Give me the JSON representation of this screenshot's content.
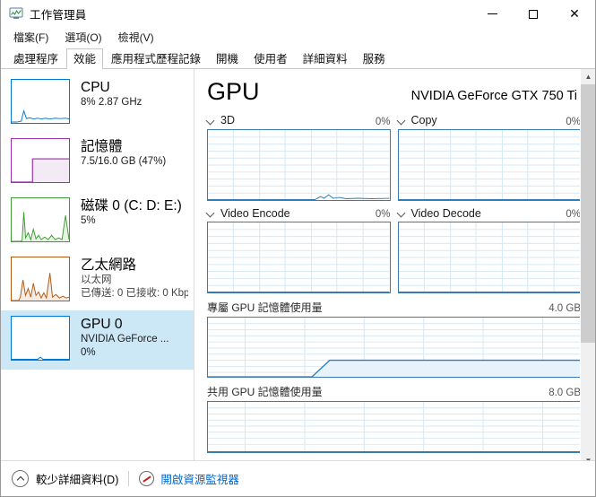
{
  "window": {
    "title": "工作管理員",
    "icon": "task-manager-icon",
    "minimize_label": "—",
    "maximize_label": "□",
    "close_label": "✕"
  },
  "menu": {
    "items": [
      {
        "label": "檔案(F)"
      },
      {
        "label": "選項(O)"
      },
      {
        "label": "檢視(V)"
      }
    ]
  },
  "tabs": {
    "active_index": 1,
    "items": [
      {
        "label": "處理程序"
      },
      {
        "label": "效能"
      },
      {
        "label": "應用程式歷程記錄"
      },
      {
        "label": "開機"
      },
      {
        "label": "使用者"
      },
      {
        "label": "詳細資料"
      },
      {
        "label": "服務"
      }
    ]
  },
  "sidebar": {
    "items": [
      {
        "title": "CPU",
        "sub1": "8%  2.87 GHz",
        "sub2": "",
        "sub3": "",
        "color": "#0078d7",
        "selected": false
      },
      {
        "title": "記憶體",
        "sub1": "7.5/16.0 GB (47%)",
        "sub2": "",
        "sub3": "",
        "color": "#9b2fae",
        "selected": false
      },
      {
        "title": "磁碟 0 (C: D: E:)",
        "sub1": "5%",
        "sub2": "",
        "sub3": "",
        "color": "#3f9c35",
        "selected": false
      },
      {
        "title": "乙太網路",
        "sub1": "以太网",
        "sub2": "已傳送: 0 已接收: 0 Kbp",
        "sub3": "",
        "color": "#b05a16",
        "selected": false
      },
      {
        "title": "GPU 0",
        "sub1": "NVIDIA GeForce ...",
        "sub2": "0%",
        "sub3": "",
        "color": "#0078d7",
        "selected": true
      }
    ]
  },
  "main": {
    "title": "GPU",
    "device": "NVIDIA GeForce GTX 750 Ti",
    "engines": [
      {
        "label": "3D",
        "value": "0%",
        "icon": "chevron-down-icon"
      },
      {
        "label": "Copy",
        "value": "0%",
        "icon": "chevron-down-icon"
      },
      {
        "label": "Video Encode",
        "value": "0%",
        "icon": "chevron-down-icon"
      },
      {
        "label": "Video Decode",
        "value": "0%",
        "icon": "chevron-down-icon"
      }
    ],
    "memory": [
      {
        "label": "專屬 GPU 記憶體使用量",
        "max": "4.0 GB"
      },
      {
        "label": "共用 GPU 記憶體使用量",
        "max": "8.0 GB"
      }
    ]
  },
  "scrollbar": {
    "up_arrow": "▲",
    "down_arrow": "▼"
  },
  "statusbar": {
    "less_details": "較少詳細資料(D)",
    "resource_monitor": "開啟資源監視器",
    "chevron_icon": "chevron-up-icon",
    "resource_icon": "resource-monitor-icon"
  },
  "colors": {
    "accent": "#0078d7",
    "graph_border": "#3a7cb0",
    "selection": "#cce8f7",
    "link": "#0066cc"
  }
}
